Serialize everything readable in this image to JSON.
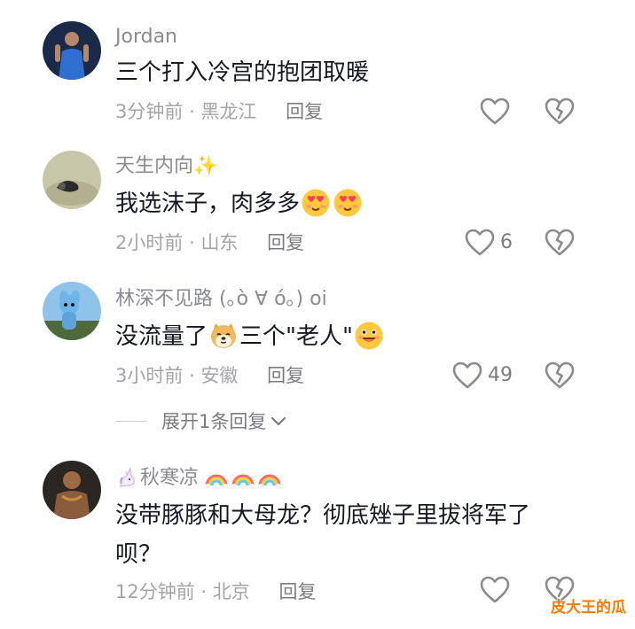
{
  "comments": [
    {
      "username": "Jordan",
      "text_parts": [
        "三个打入冷宫的抱团取暖"
      ],
      "time": "3分钟前",
      "location": "黑龙江",
      "reply_label": "回复",
      "like_count": ""
    },
    {
      "username": "天生内向✨",
      "text_parts": [
        "我选沫子，肉多多"
      ],
      "emoji_after": [
        "heart-eyes-emoji",
        "heart-eyes-emoji"
      ],
      "time": "2小时前",
      "location": "山东",
      "reply_label": "回复",
      "like_count": "6"
    },
    {
      "username": "林深不见路 (｡ò ∀ ó｡) oi",
      "text_parts": [
        "没流量了",
        "三个\"老人\""
      ],
      "emoji_inline": [
        "doge-emoji",
        "grin-emoji"
      ],
      "time": "3小时前",
      "location": "安徽",
      "reply_label": "回复",
      "like_count": "49"
    },
    {
      "username": "秋寒凉",
      "username_prefix_icon": "unicorn-icon",
      "username_suffix_icons": [
        "rainbow-icon",
        "rainbow-icon",
        "rainbow-icon"
      ],
      "text_lines": [
        "没带豚豚和大母龙？彻底矬子里拔将军了",
        "呗？"
      ],
      "time": "12分钟前",
      "location": "北京",
      "reply_label": "回复",
      "like_count": ""
    }
  ],
  "separator": "·",
  "expand_replies": "展开1条回复",
  "watermark": "皮大王的瓜",
  "colors": {
    "meta": "#a3a4a9",
    "text": "#161823",
    "watermark": "#ff7a00"
  }
}
